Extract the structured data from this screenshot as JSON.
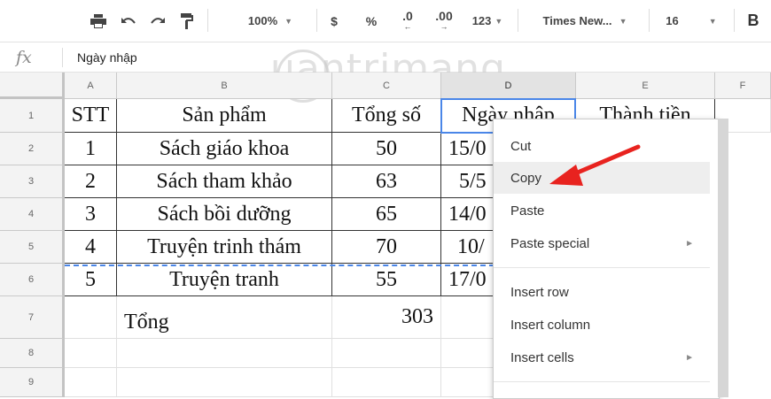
{
  "toolbar": {
    "zoom": "100%",
    "currency": "$",
    "percent": "%",
    "dec_decrease": ".0",
    "dec_increase": ".00",
    "number_format": "123",
    "font_name": "Times New...",
    "font_size": "16",
    "bold": "B"
  },
  "formula_bar": {
    "fx": "fx",
    "value": "Ngày nhập"
  },
  "columns": [
    "A",
    "B",
    "C",
    "D",
    "E",
    "F"
  ],
  "rows": [
    "1",
    "2",
    "3",
    "4",
    "5",
    "6",
    "7",
    "8",
    "9"
  ],
  "cells": {
    "header": {
      "stt": "STT",
      "product": "Sản phẩm",
      "total": "Tổng số",
      "date": "Ngày nhập",
      "amount": "Thành tiền"
    },
    "data": [
      {
        "stt": "1",
        "product": "Sách giáo khoa",
        "total": "50",
        "date": "15/0"
      },
      {
        "stt": "2",
        "product": "Sách tham khảo",
        "total": "63",
        "date": "5/5"
      },
      {
        "stt": "3",
        "product": "Sách bồi dưỡng",
        "total": "65",
        "date": "14/0"
      },
      {
        "stt": "4",
        "product": "Truyện trinh thám",
        "total": "70",
        "date": "10/"
      },
      {
        "stt": "5",
        "product": "Truyện tranh",
        "total": "55",
        "date": "17/0"
      }
    ],
    "total_label": "Tổng",
    "total_value": "303"
  },
  "context_menu": {
    "items": [
      {
        "label": "Cut",
        "submenu": false
      },
      {
        "label": "Copy",
        "submenu": false,
        "highlighted": true
      },
      {
        "label": "Paste",
        "submenu": false
      },
      {
        "label": "Paste special",
        "submenu": true
      },
      {
        "label": "Insert row",
        "submenu": false
      },
      {
        "label": "Insert column",
        "submenu": false
      },
      {
        "label": "Insert cells",
        "submenu": true
      }
    ],
    "submenu_glyph": "►"
  },
  "watermark": "uantrimang",
  "colors": {
    "accent": "#4a86e8",
    "arrow": "#e8231f",
    "menu_highlight": "#eeeeee"
  }
}
